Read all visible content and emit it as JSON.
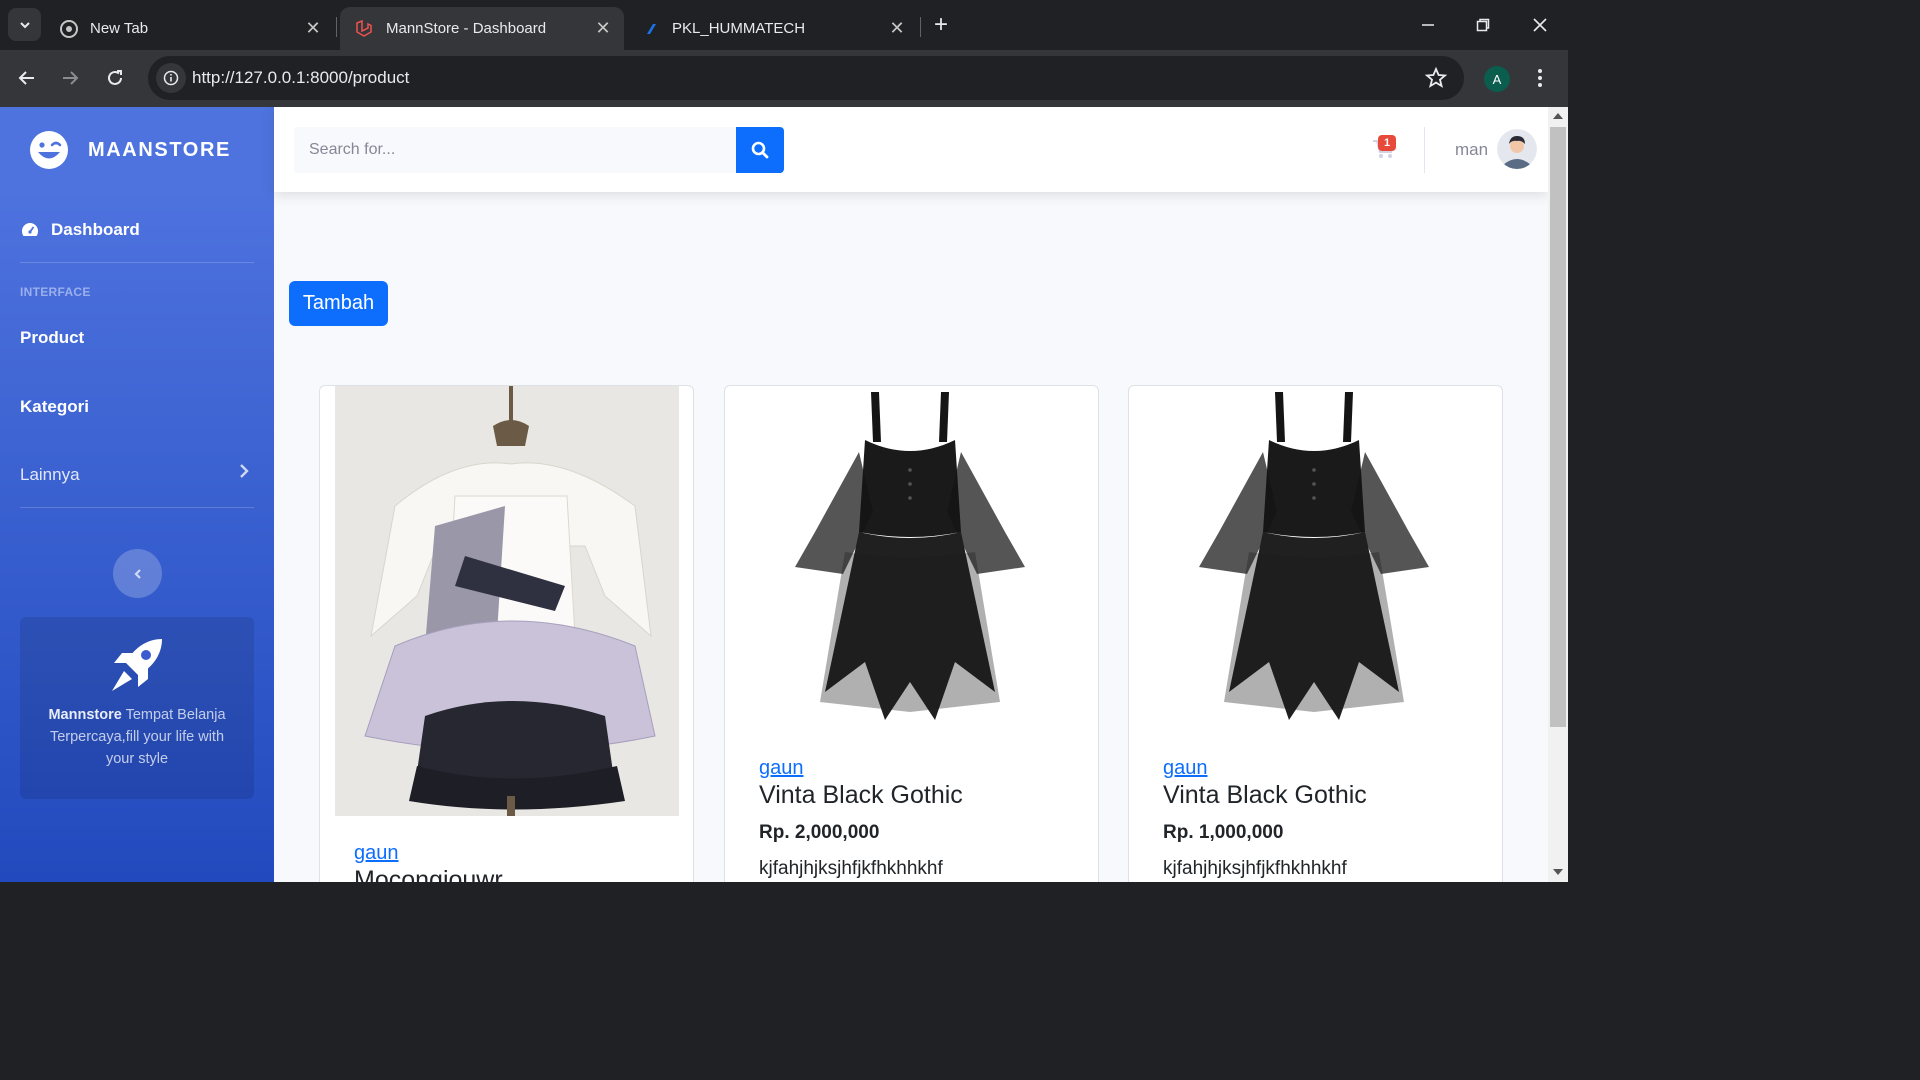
{
  "browser": {
    "tabs": [
      {
        "title": "New Tab",
        "active": false
      },
      {
        "title": "MannStore - Dashboard",
        "active": true
      },
      {
        "title": "PKL_HUMMATECH",
        "active": false
      }
    ],
    "url_host": "http://127.0.0.1",
    "url_rest": ":8000/product",
    "profile_initial": "A"
  },
  "sidebar": {
    "brand": "MAANSTORE",
    "dashboard": "Dashboard",
    "heading": "INTERFACE",
    "items": [
      {
        "label": "Product"
      },
      {
        "label": "Kategori"
      },
      {
        "label": "Lainnya"
      }
    ],
    "card": {
      "brand": "Mannstore",
      "text": " Tempat Belanja Terpercaya,fill your life with your style"
    }
  },
  "topbar": {
    "search_placeholder": "Search for...",
    "cart_count": "1",
    "username": "man"
  },
  "main": {
    "add_button": "Tambah",
    "products": [
      {
        "category": "gaun",
        "name": "Mocongiouwr",
        "price": "",
        "desc": ""
      },
      {
        "category": "gaun",
        "name": "Vinta Black Gothic",
        "price": "Rp. 2,000,000",
        "desc": "kjfahjhjksjhfjkfhkhhkhf"
      },
      {
        "category": "gaun",
        "name": "Vinta Black Gothic",
        "price": "Rp. 1,000,000",
        "desc": "kjfahjhjksjhfjkfhkhhkhf"
      }
    ]
  },
  "colors": {
    "primary": "#4e73df",
    "button": "#0d6efd",
    "badge": "#e74a3b"
  }
}
